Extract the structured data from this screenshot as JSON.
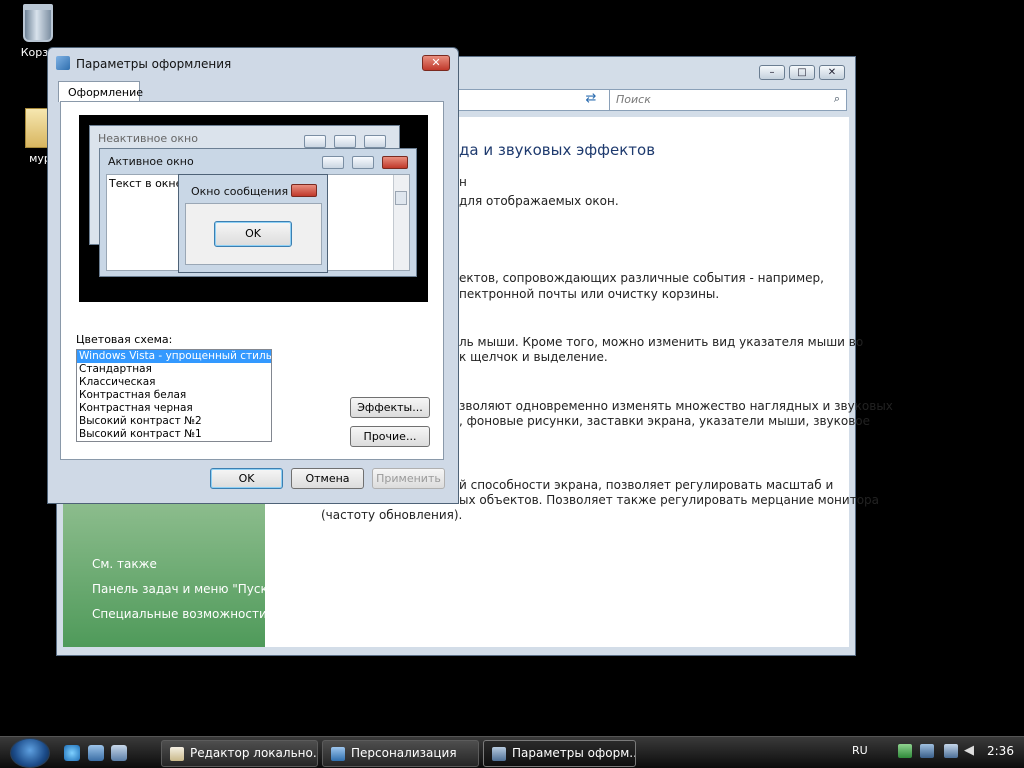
{
  "desktop": {
    "icons": [
      {
        "label": "Корзи"
      },
      {
        "label": "мур"
      }
    ]
  },
  "control_panel": {
    "search_placeholder": "Поиск",
    "heading": "да и звуковых эффектов",
    "lines": [
      "н",
      "для отображаемых окон.",
      "ектов, сопровождающих различные события - например,",
      "пектронной почты или очистку корзины.",
      "ль мыши. Кроме того, можно изменить вид указателя мыши во",
      "к щелчок и выделение.",
      "зволяют одновременно изменять множество наглядных и звуковых",
      ", фоновые рисунки, заставки экрана, указатели мыши, звуковое",
      "й способности экрана, позволяет регулировать масштаб и",
      "ых объектов. Позволяет также регулировать мерцание монитора",
      "(частоту обновления)."
    ],
    "see_also": {
      "title": "См. также",
      "links": [
        "Панель задач и меню \"Пуск\"",
        "Специальные возможности"
      ]
    }
  },
  "dialog": {
    "title": "Параметры оформления",
    "tab": "Оформление",
    "preview": {
      "inactive_window": "Неактивное окно",
      "active_window": "Активное окно",
      "window_text": "Текст в окне",
      "message_box": "Окно сообщения",
      "ok": "OK"
    },
    "color_scheme_label": "Цветовая схема:",
    "color_schemes": [
      "Windows Vista - упрощенный стиль",
      "Стандартная",
      "Классическая",
      "Контрастная белая",
      "Контрастная черная",
      "Высокий контраст №2",
      "Высокий контраст №1"
    ],
    "selected_scheme": "Windows Vista - упрощенный стиль",
    "effects_button": "Эффекты...",
    "advanced_button": "Прочие...",
    "ok_button": "OK",
    "cancel_button": "Отмена",
    "apply_button": "Применить"
  },
  "taskbar": {
    "tasks": [
      {
        "label": "Редактор локально..."
      },
      {
        "label": "Персонализация"
      },
      {
        "label": "Параметры оформ..."
      }
    ],
    "language": "RU",
    "clock": "2:36"
  }
}
